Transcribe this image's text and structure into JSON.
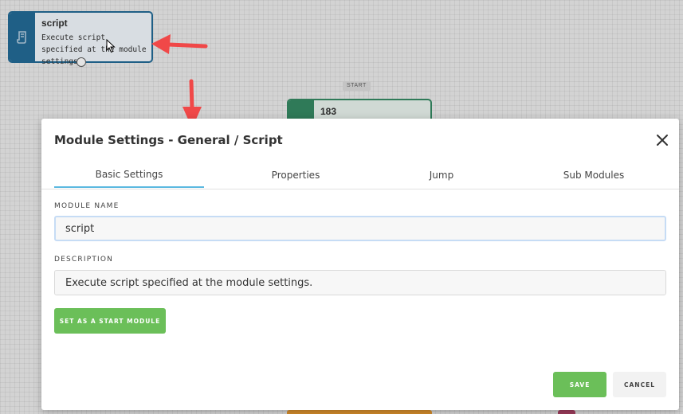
{
  "canvas": {
    "script_node": {
      "title": "script",
      "description": "Execute script specified at the module settings."
    },
    "start_badge": "START",
    "start_node": {
      "title": "183"
    }
  },
  "modal": {
    "title": "Module Settings - General / Script",
    "tabs": [
      {
        "label": "Basic Settings",
        "active": true
      },
      {
        "label": "Properties",
        "active": false
      },
      {
        "label": "Jump",
        "active": false
      },
      {
        "label": "Sub Modules",
        "active": false
      }
    ],
    "module_name": {
      "label": "MODULE NAME",
      "value": "script"
    },
    "description": {
      "label": "DESCRIPTION",
      "value": "Execute script specified at the module settings."
    },
    "start_button": "SET AS A START MODULE",
    "save_button": "SAVE",
    "cancel_button": "CANCEL"
  },
  "colors": {
    "accent_green": "#6bbf59",
    "tab_underline": "#5bb8e0",
    "script_node": "#1f5f86",
    "start_node": "#2f7a58",
    "annotation_arrow": "#f04848"
  }
}
